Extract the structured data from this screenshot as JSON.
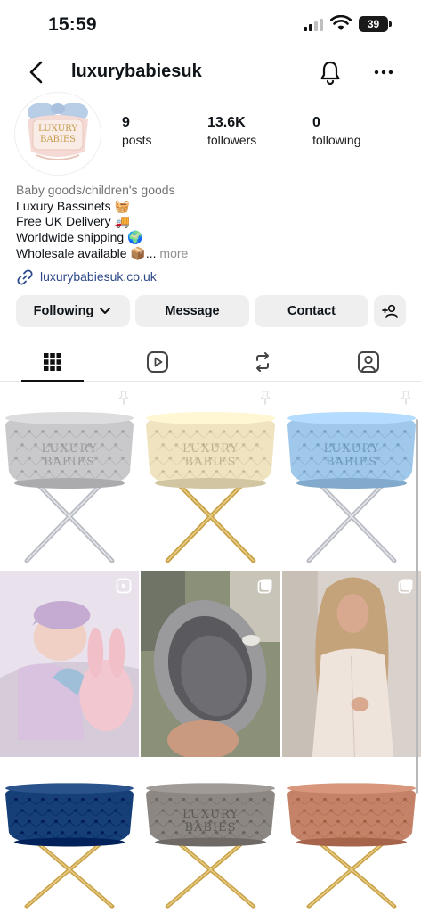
{
  "status_bar": {
    "time": "15:59",
    "battery": "39"
  },
  "header": {
    "username": "luxurybabiesuk"
  },
  "profile": {
    "avatar_logo_line1": "LUXURY",
    "avatar_logo_line2": "BABIES",
    "posts_count": "9",
    "posts_label": "posts",
    "followers_count": "13.6K",
    "followers_label": "followers",
    "following_count": "0",
    "following_label": "following"
  },
  "bio": {
    "category": "Baby goods/children's goods",
    "line1": "Luxury Bassinets 🧺",
    "line2": "Free UK Delivery 🚚",
    "line3": "Worldwide shipping 🌍",
    "line4": "Wholesale available 📦...",
    "more": "more",
    "link": "luxurybabiesuk.co.uk"
  },
  "actions": {
    "following": "Following",
    "message": "Message",
    "contact": "Contact"
  },
  "tabs": [
    "grid-icon",
    "reels-icon",
    "reposts-icon",
    "tagged-icon"
  ],
  "posts": [
    {
      "kind": "bassinet",
      "color": "#c9c9cc",
      "legs": "silver",
      "corner": "pin-icon",
      "logo": "LUXURY BABIES"
    },
    {
      "kind": "bassinet",
      "color": "#efe3c0",
      "legs": "gold",
      "corner": "pin-icon",
      "logo": "LUXURY BABIES"
    },
    {
      "kind": "bassinet",
      "color": "#9fc8ea",
      "legs": "silver",
      "corner": "pin-icon",
      "logo": "LUXURY BABIES"
    },
    {
      "kind": "photo-baby",
      "corner": "reel-icon"
    },
    {
      "kind": "photo-basket",
      "corner": "multi-post-icon"
    },
    {
      "kind": "photo-woman",
      "corner": "multi-post-icon"
    },
    {
      "kind": "bassinet",
      "color": "#163f78",
      "legs": "gold",
      "corner": "multi-post-icon",
      "logo": ""
    },
    {
      "kind": "bassinet",
      "color": "#8c8782",
      "legs": "gold",
      "corner": "multi-post-icon",
      "logo": "LUXURY BABIES"
    },
    {
      "kind": "bassinet",
      "color": "#c48368",
      "legs": "gold",
      "corner": "multi-post-icon",
      "logo": ""
    }
  ],
  "colors": {
    "link": "#2f4a8a",
    "button_bg": "#efefef"
  }
}
